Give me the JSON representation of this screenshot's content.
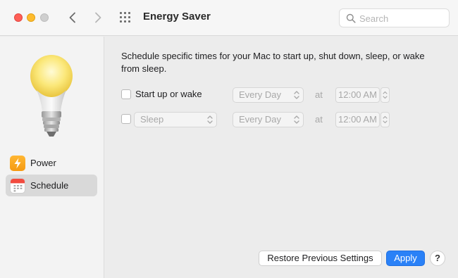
{
  "window": {
    "title": "Energy Saver"
  },
  "search": {
    "placeholder": "Search"
  },
  "sidebar": {
    "items": [
      {
        "label": "Power",
        "icon": "lightning-bolt-icon",
        "selected": false
      },
      {
        "label": "Schedule",
        "icon": "calendar-icon",
        "selected": true
      }
    ]
  },
  "main": {
    "description": "Schedule specific times for your Mac to start up, shut down, sleep, or wake from sleep.",
    "rows": [
      {
        "checkbox_label": "Start up or wake",
        "checked": false,
        "frequency": "Every Day",
        "at_label": "at",
        "time": "12:00 AM"
      },
      {
        "checked": false,
        "action": "Sleep",
        "frequency": "Every Day",
        "at_label": "at",
        "time": "12:00 AM"
      }
    ],
    "restore_label": "Restore Previous Settings",
    "apply_label": "Apply",
    "help_label": "?"
  },
  "colors": {
    "accent": "#2a81f7",
    "close": "#ff5f57",
    "minimize": "#febc2e",
    "power_icon": "#f59a12"
  }
}
